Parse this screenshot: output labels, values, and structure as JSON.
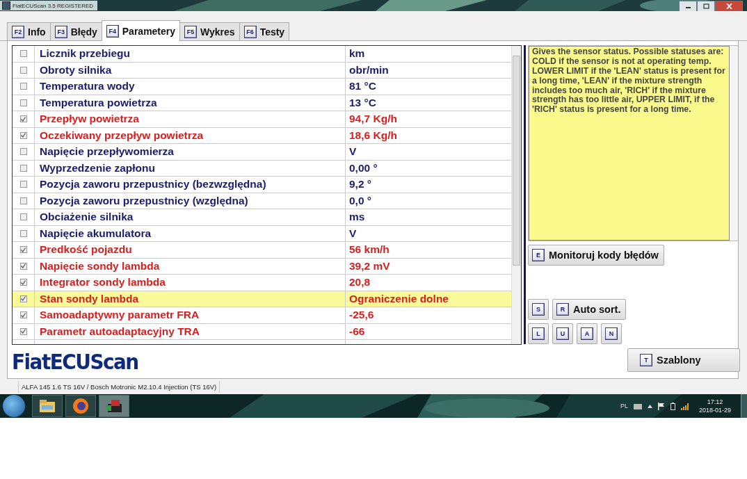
{
  "window": {
    "title": "FiatECUScan 3.5 REGISTERED"
  },
  "tabs": [
    {
      "key": "F2",
      "label": "Info",
      "selected": false
    },
    {
      "key": "F3",
      "label": "Błędy",
      "selected": false
    },
    {
      "key": "F4",
      "label": "Parametery",
      "selected": true
    },
    {
      "key": "F5",
      "label": "Wykres",
      "selected": false
    },
    {
      "key": "F6",
      "label": "Testy",
      "selected": false
    }
  ],
  "parameters": [
    {
      "name": "Licznik przebiegu",
      "value": "km",
      "checked": false,
      "selected": false
    },
    {
      "name": "Obroty silnika",
      "value": "obr/min",
      "checked": false,
      "selected": false
    },
    {
      "name": "Temperatura wody",
      "value": "81 °C",
      "checked": false,
      "selected": false
    },
    {
      "name": "Temperatura powietrza",
      "value": "13 °C",
      "checked": false,
      "selected": false
    },
    {
      "name": "Przepływ powietrza",
      "value": "94,7 Kg/h",
      "checked": true,
      "selected": false
    },
    {
      "name": "Oczekiwany przepływ powietrza",
      "value": "18,6 Kg/h",
      "checked": true,
      "selected": false
    },
    {
      "name": "Napięcie przepływomierza",
      "value": "V",
      "checked": false,
      "selected": false
    },
    {
      "name": "Wyprzedzenie zapłonu",
      "value": "0,00 °",
      "checked": false,
      "selected": false
    },
    {
      "name": "Pozycja zaworu przepustnicy (bezwzględna)",
      "value": "9,2 °",
      "checked": false,
      "selected": false
    },
    {
      "name": "Pozycja zaworu przepustnicy (względna)",
      "value": "0,0 °",
      "checked": false,
      "selected": false
    },
    {
      "name": "Obciażenie silnika",
      "value": "ms",
      "checked": false,
      "selected": false
    },
    {
      "name": "Napięcie akumulatora",
      "value": "V",
      "checked": false,
      "selected": false
    },
    {
      "name": "Predkość pojazdu",
      "value": "56 km/h",
      "checked": true,
      "selected": false
    },
    {
      "name": "Napięcie sondy lambda",
      "value": "39,2 mV",
      "checked": true,
      "selected": false
    },
    {
      "name": "Integrator sondy lambda",
      "value": "20,8",
      "checked": true,
      "selected": false
    },
    {
      "name": "Stan sondy lambda",
      "value": "Ograniczenie dolne",
      "checked": true,
      "selected": true
    },
    {
      "name": "Samoadaptywny parametr FRA",
      "value": "-25,6",
      "checked": true,
      "selected": false
    },
    {
      "name": "Parametr autoadaptacyjny TRA",
      "value": "-66",
      "checked": true,
      "selected": false
    }
  ],
  "description": "Gives the sensor status. Possible statuses are: COLD if the sensor is not at operating temp. LOWER LIMIT if the 'LEAN' status is present for a long time, 'LEAN' if the mixture strength includes too much air, 'RICH' if the mixture strength has too little air, UPPER LIMIT, if the 'RICH' status is present for a long time.",
  "buttons": {
    "monitor": {
      "key": "E",
      "label": "Monitoruj kody błędów"
    },
    "sort": [
      {
        "key": "S"
      },
      {
        "key": "R",
        "label": "Auto sort."
      }
    ],
    "letters": [
      {
        "key": "L"
      },
      {
        "key": "U"
      },
      {
        "key": "A"
      },
      {
        "key": "N"
      }
    ],
    "templates": {
      "key": "T",
      "label": "Szablony"
    }
  },
  "logo": "FiatECUScan",
  "status_bar": "ALFA 145 1.6 TS 16V / Bosch Motronic M2.10.4 Injection (TS 16V)",
  "taskbar": {
    "language": "PL",
    "time": "17:12",
    "date": "2018-01-29"
  }
}
